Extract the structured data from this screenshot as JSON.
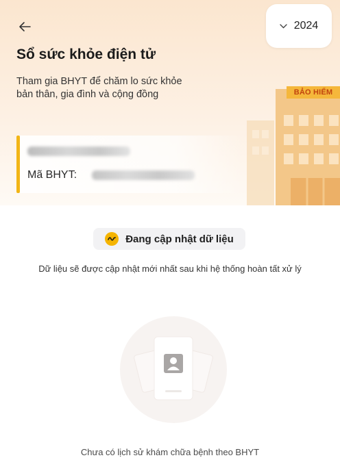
{
  "header": {
    "back_icon": "arrow-left-icon",
    "year_select": {
      "chevron_icon": "chevron-down-icon",
      "value": "2024"
    },
    "title": "Sổ sức khỏe điện tử",
    "subtitle_line1": "Tham gia BHYT để chăm lo sức khỏe",
    "subtitle_line2": "bản thân, gia đình và cộng đồng",
    "building_sign": "BẢO HIỂM",
    "accent_color": "#f2b516"
  },
  "card": {
    "name_redacted": true,
    "bhyt_label": "Mã BHYT:",
    "bhyt_code_redacted": true
  },
  "status": {
    "icon": "activity-wave-icon",
    "label": "Đang cập nhật dữ liệu",
    "description": "Dữ liệu sẽ được cập nhật mới nhất sau khi hệ thống hoàn tất xử lý"
  },
  "empty_state": {
    "icon": "contact-card-icon",
    "message": "Chưa có lịch sử khám chữa bệnh theo BHYT"
  }
}
